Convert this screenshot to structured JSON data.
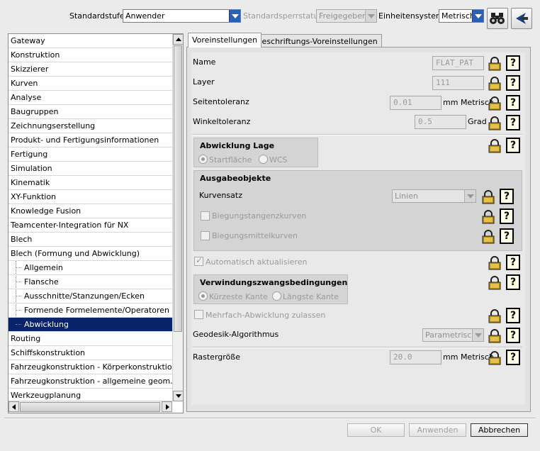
{
  "toolbar": {
    "standard_level_label": "Standardstufe",
    "standard_level_value": "Anwender",
    "lock_status_label": "Standardsperrstatus",
    "lock_status_value": "Freigegeben",
    "unit_system_label": "Einheitensystem",
    "unit_system_value": "Metrisch"
  },
  "tree": {
    "items": [
      {
        "label": "Gateway"
      },
      {
        "label": "Konstruktion"
      },
      {
        "label": "Skizzierer"
      },
      {
        "label": "Kurven"
      },
      {
        "label": "Analyse"
      },
      {
        "label": "Baugruppen"
      },
      {
        "label": "Zeichnungserstellung"
      },
      {
        "label": "Produkt- und Fertigungsinformationen"
      },
      {
        "label": "Fertigung"
      },
      {
        "label": "Simulation"
      },
      {
        "label": "Kinematik"
      },
      {
        "label": "XY-Funktion"
      },
      {
        "label": "Knowledge Fusion"
      },
      {
        "label": "Teamcenter-Integration für NX"
      },
      {
        "label": "Blech"
      },
      {
        "label": "Blech (Formung und Abwicklung)"
      },
      {
        "label": "Allgemein"
      },
      {
        "label": "Flansche"
      },
      {
        "label": "Ausschnitte/Stanzungen/Ecken"
      },
      {
        "label": "Formende Formelemente/Operatoren"
      },
      {
        "label": "Abwicklung"
      },
      {
        "label": "Routing"
      },
      {
        "label": "Schiffskonstruktion"
      },
      {
        "label": "Fahrzeugkonstruktion - Körperkonstruktion"
      },
      {
        "label": "Fahrzeugkonstruktion - allgemeine geom."
      },
      {
        "label": "Werkzeugplanung"
      }
    ]
  },
  "tabs": {
    "settings": "Voreinstellungen",
    "annotation": "Beschriftungs-Voreinstellungen"
  },
  "form": {
    "name_label": "Name",
    "name_value": "FLAT_PAT",
    "layer_label": "Layer",
    "layer_value": "111",
    "side_tol_label": "Seitentoleranz",
    "side_tol_value": "0.01",
    "side_tol_unit": "mm",
    "side_tol_unit2": "Metrisch",
    "angle_tol_label": "Winkeltoleranz",
    "angle_tol_value": "0.5",
    "angle_tol_unit": "Grad",
    "flat_pos_title": "Abwicklung Lage",
    "flat_pos_opt1": "Startfläche",
    "flat_pos_opt2": "WCS",
    "output_title": "Ausgabeobjekte",
    "curve_set_label": "Kurvensatz",
    "curve_set_value": "Linien",
    "bend_tangent": "Biegungstangenzkurven",
    "bend_center": "Biegungsmittelkurven",
    "auto_update": "Automatisch aktualisieren",
    "warp_title": "Verwindungszwangsbedingungen",
    "warp_opt1": "Kürzeste Kante",
    "warp_opt2": "Längste Kante",
    "multi_flat": "Mehrfach-Abwicklung zulassen",
    "geodesic_label": "Geodesik-Algorithmus",
    "geodesic_value": "Parametrisch",
    "grid_label": "Rastergröße",
    "grid_value": "20.0",
    "grid_unit": "mm",
    "grid_unit2": "Metrisch",
    "help_glyph": "?"
  },
  "buttons": {
    "ok": "OK",
    "apply": "Anwenden",
    "cancel": "Abbrechen"
  },
  "colors": {
    "selection": "#0a246a",
    "accent_blue": "#2a5fb8"
  }
}
